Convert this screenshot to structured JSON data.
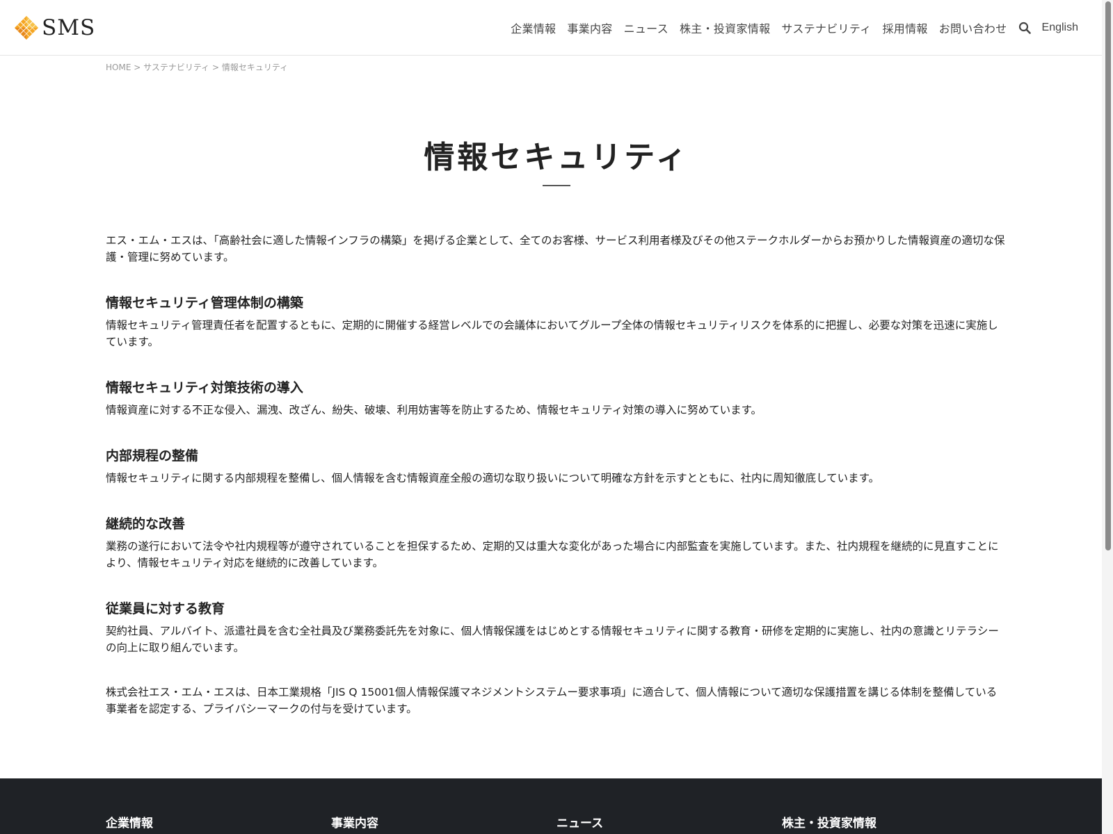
{
  "header": {
    "logo_text": "SMS",
    "nav": [
      "企業情報",
      "事業内容",
      "ニュース",
      "株主・投資家情報",
      "サステナビリティ",
      "採用情報",
      "お問い合わせ"
    ],
    "language": "English"
  },
  "breadcrumb": [
    "HOME",
    "サステナビリティ",
    "情報セキュリティ"
  ],
  "breadcrumb_sep": ">",
  "page_title": "情報セキュリティ",
  "intro": "エス・エム・エスは、「高齢社会に適した情報インフラの構築」を掲げる企業として、全てのお客様、サービス利用者様及びその他ステークホルダーからお預かりした情報資産の適切な保護・管理に努めています。",
  "sections": [
    {
      "title": "情報セキュリティ管理体制の構築",
      "body": "情報セキュリティ管理責任者を配置するともに、定期的に開催する経営レベルでの会議体においてグループ全体の情報セキュリティリスクを体系的に把握し、必要な対策を迅速に実施しています。"
    },
    {
      "title": "情報セキュリティ対策技術の導入",
      "body": "情報資産に対する不正な侵入、漏洩、改ざん、紛失、破壊、利用妨害等を防止するため、情報セキュリティ対策の導入に努めています。"
    },
    {
      "title": "内部規程の整備",
      "body": "情報セキュリティに関する内部規程を整備し、個人情報を含む情報資産全般の適切な取り扱いについて明確な方針を示すとともに、社内に周知徹底しています。"
    },
    {
      "title": "継続的な改善",
      "body": "業務の遂行において法令や社内規程等が遵守されていることを担保するため、定期的又は重大な変化があった場合に内部監査を実施しています。また、社内規程を継続的に見直すことにより、情報セキュリティ対応を継続的に改善しています。"
    },
    {
      "title": "従業員に対する教育",
      "body": "契約社員、アルバイト、派遣社員を含む全社員及び業務委託先を対象に、個人情報保護をはじめとする情報セキュリティに関する教育・研修を定期的に実施し、社内の意識とリテラシーの向上に取り組んでいます。"
    }
  ],
  "privacy_mark_text": "株式会社エス・エム・エスは、日本工業規格「JIS Q 15001個人情報保護マネジメントシステムー要求事項」に適合して、個人情報について適切な保護措置を講じる体制を整備している事業者を認定する、プライバシーマークの付与を受けています。",
  "footer": {
    "columns": [
      "企業情報",
      "事業内容",
      "ニュース",
      "株主・投資家情報"
    ]
  },
  "colors": {
    "logo_accent": "#f5a623",
    "footer_bg": "#1f2226"
  },
  "icons": [
    "sms-logo-icon",
    "search-icon"
  ]
}
